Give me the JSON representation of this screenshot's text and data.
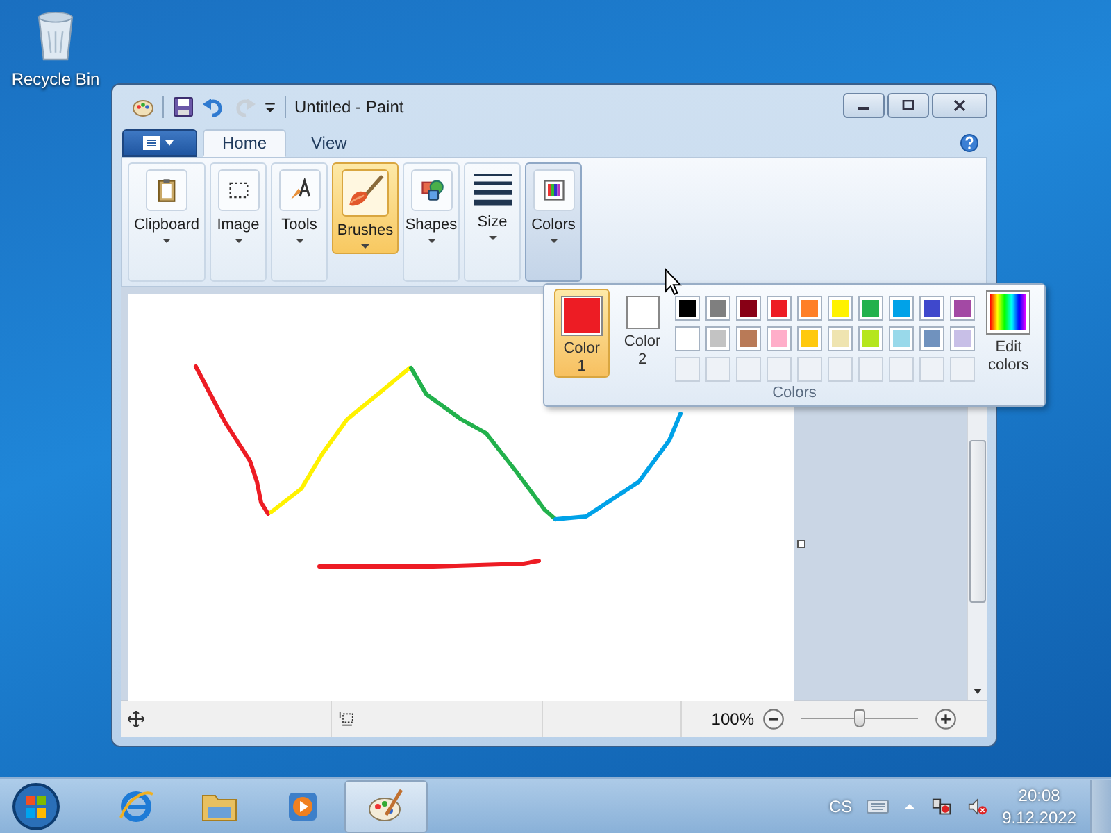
{
  "desktop": {
    "icons": [
      {
        "label": "Recycle Bin",
        "kind": "recycle"
      }
    ]
  },
  "window": {
    "title": "Untitled - Paint",
    "redo_disabled": true
  },
  "tabs": [
    {
      "label": "Home",
      "selected": true
    },
    {
      "label": "View",
      "selected": false
    }
  ],
  "ribbon_groups": [
    {
      "label": "Clipboard",
      "kind": "clipboard",
      "selected": false,
      "expanded": false
    },
    {
      "label": "Image",
      "kind": "image",
      "selected": false,
      "expanded": false
    },
    {
      "label": "Tools",
      "kind": "tools",
      "selected": false,
      "expanded": false
    },
    {
      "label": "Brushes",
      "kind": "brushes",
      "selected": true,
      "expanded": false
    },
    {
      "label": "Shapes",
      "kind": "shapes",
      "selected": false,
      "expanded": false
    },
    {
      "label": "Size",
      "kind": "size",
      "selected": false,
      "expanded": false
    },
    {
      "label": "Colors",
      "kind": "colors",
      "selected": false,
      "expanded": true
    }
  ],
  "colors_popup": {
    "caption": "Colors",
    "slots": [
      {
        "label": "Color 1",
        "color": "#ed1c24",
        "selected": true
      },
      {
        "label": "Color 2",
        "color": "#ffffff",
        "selected": false
      }
    ],
    "palette": [
      {
        "color": "#000000"
      },
      {
        "color": "#7f7f7f"
      },
      {
        "color": "#880015"
      },
      {
        "color": "#ed1c24"
      },
      {
        "color": "#ff7f27"
      },
      {
        "color": "#fff200"
      },
      {
        "color": "#22b14c"
      },
      {
        "color": "#00a2e8"
      },
      {
        "color": "#3f48cc"
      },
      {
        "color": "#a349a4"
      },
      {
        "color": "#ffffff"
      },
      {
        "color": "#c3c3c3"
      },
      {
        "color": "#b97a57"
      },
      {
        "color": "#ffaec9"
      },
      {
        "color": "#ffc90e"
      },
      {
        "color": "#efe4b0"
      },
      {
        "color": "#b5e61d"
      },
      {
        "color": "#99d9ea"
      },
      {
        "color": "#7092be"
      },
      {
        "color": "#c8bfe7"
      }
    ],
    "edit_label": "Edit colors"
  },
  "status_bar": {
    "zoom": "100%",
    "zoom_slider": {
      "level": 0.5
    }
  },
  "taskbar": {
    "items": [
      {
        "kind": "ie",
        "selected": false
      },
      {
        "kind": "explorer",
        "selected": false
      },
      {
        "kind": "media",
        "selected": false
      },
      {
        "kind": "paint",
        "selected": true
      }
    ],
    "language": "CS",
    "time": "20:08",
    "date": "9.12.2022"
  }
}
